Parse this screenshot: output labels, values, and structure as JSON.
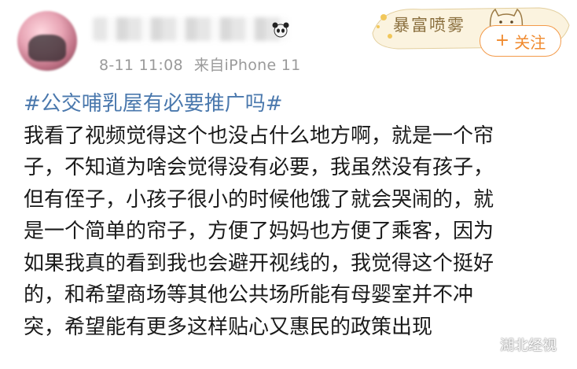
{
  "post": {
    "timestamp": "8-11 11:08",
    "source": "来自iPhone 11",
    "follow_label": "关注",
    "follow_plus": "+",
    "sticker_text": "暴富喷雾",
    "topic": "#公交哺乳屋有必要推广吗#",
    "lines": [
      "我看了视频觉得这个也没占什么地方啊，就是一个帘",
      "子，不知道为啥会觉得没有必要，我虽然没有孩子，",
      "但有侄子，小孩子很小的时候他饿了就会哭闹的，就",
      "是一个简单的帘子，方便了妈妈也方便了乘客，因为",
      "如果我真的看到我也会避开视线的，我觉得这个挺好",
      "的，和希望商场等其他公共场所能有母婴室并不冲",
      "突，希望能有更多这样贴心又惠民的政策出现"
    ]
  },
  "watermark": {
    "text": "湖北经视"
  },
  "colors": {
    "topic": "#4a78ad",
    "accent": "#f08a2e",
    "meta": "#9a9a9a"
  }
}
